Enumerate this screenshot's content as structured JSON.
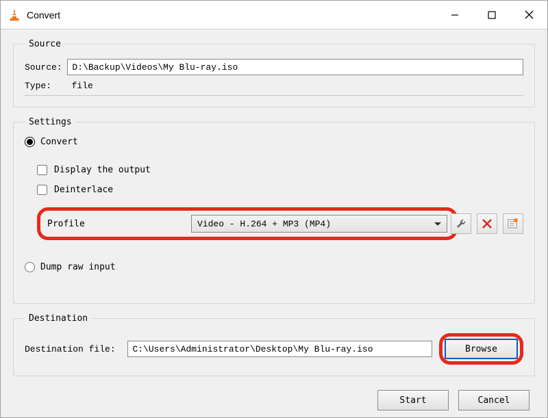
{
  "window": {
    "title": "Convert"
  },
  "source": {
    "legend": "Source",
    "source_label": "Source: ",
    "source_value": "D:\\Backup\\Videos\\My Blu-ray.iso",
    "type_label": "Type:  ",
    "type_value": "file"
  },
  "settings": {
    "legend": "Settings",
    "convert_label": "Convert",
    "display_output_label": "Display the output",
    "deinterlace_label": "Deinterlace",
    "profile_label": "Profile",
    "profile_value": "Video - H.264 + MP3 (MP4)",
    "dump_raw_label": "Dump raw input"
  },
  "destination": {
    "legend": "Destination",
    "file_label": "Destination file: ",
    "file_value": "C:\\Users\\Administrator\\Desktop\\My Blu-ray.iso",
    "browse_label": "Browse"
  },
  "buttons": {
    "start": "Start",
    "cancel": "Cancel"
  },
  "icons": {
    "wrench": "wrench-icon",
    "delete": "delete-icon",
    "new_profile": "new-profile-icon"
  }
}
